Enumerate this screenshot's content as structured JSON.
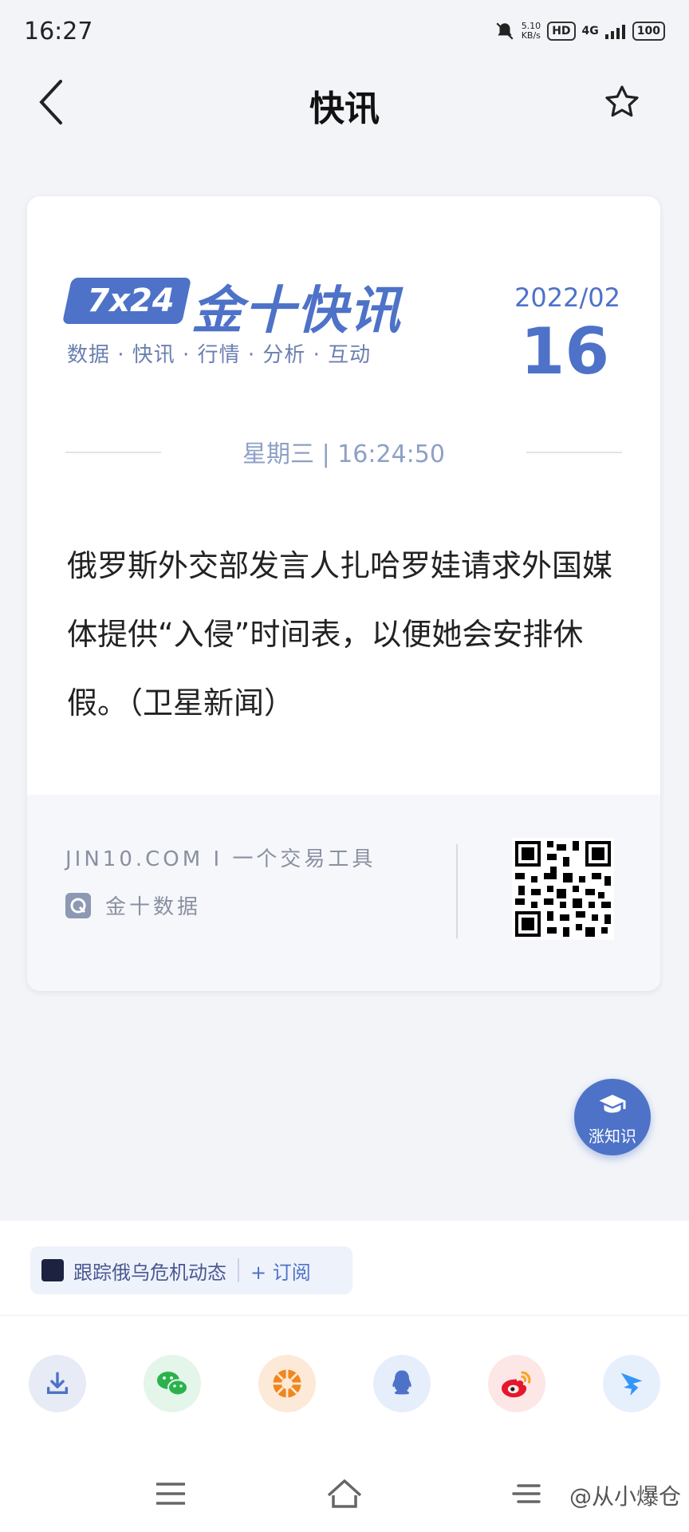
{
  "status_bar": {
    "time": "16:27",
    "net_speed": "5.10\nKB/s",
    "hd": "HD",
    "network": "4G",
    "battery": "100"
  },
  "header": {
    "title": "快讯"
  },
  "card": {
    "logo_badge": "7x24",
    "logo_name": "金十快讯",
    "tagline": "数据 · 快讯 · 行情 · 分析 · 互动",
    "date_ym": "2022/02",
    "date_d": "16",
    "weektime": "星期三 | 16:24:50",
    "news_text": "俄罗斯外交部发言人扎哈罗娃请求外国媒体提供“入侵”时间表，以便她会安排休假。（卫星新闻）",
    "footer": {
      "site": "JIN10.COM I 一个交易工具",
      "brand": "金十数据"
    }
  },
  "fab": {
    "label": "涨知识"
  },
  "subscribe": {
    "topic": "跟踪俄乌危机动态",
    "button": "+ 订阅"
  },
  "share_items": [
    "download-icon",
    "wechat-icon",
    "moments-icon",
    "qq-icon",
    "weibo-icon",
    "dingtalk-icon"
  ],
  "watermark": "@从小爆仓",
  "colors": {
    "accent": "#4e72c8",
    "background": "#f2f4f8"
  }
}
